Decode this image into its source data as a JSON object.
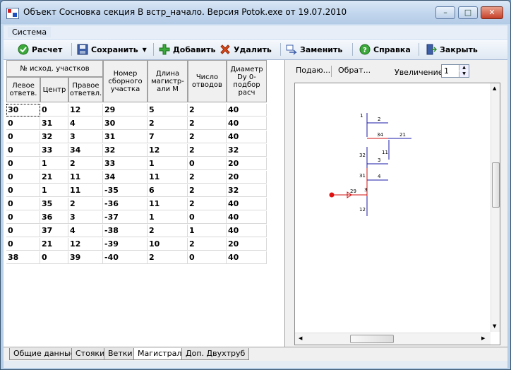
{
  "window": {
    "title": "Объект Сосновка секция В встр_начало. Версия Potok.exe от 19.07.2010"
  },
  "menu": {
    "items": [
      "Система"
    ]
  },
  "toolbar": {
    "calc": "Расчет",
    "save": "Сохранить",
    "add": "Добавить",
    "delete": "Удалить",
    "replace": "Заменить",
    "help": "Справка",
    "close": "Закрыть"
  },
  "table": {
    "group_header": "№ исход.  участков",
    "columns": [
      "Левое ответв.",
      "Центр",
      "Правое ответвл.",
      "Номер сборного участка",
      "Длина магистр-али  М",
      "Число отводов",
      "Диаметр Dy 0-подбор расч"
    ],
    "rows": [
      [
        "30",
        "0",
        "12",
        "29",
        "5",
        "2",
        "40"
      ],
      [
        "0",
        "31",
        "4",
        "30",
        "2",
        "2",
        "40"
      ],
      [
        "0",
        "32",
        "3",
        "31",
        "7",
        "2",
        "40"
      ],
      [
        "0",
        "33",
        "34",
        "32",
        "12",
        "2",
        "32"
      ],
      [
        "0",
        "1",
        "2",
        "33",
        "1",
        "0",
        "20"
      ],
      [
        "0",
        "21",
        "11",
        "34",
        "11",
        "2",
        "20"
      ],
      [
        "0",
        "1",
        "11",
        "-35",
        "6",
        "2",
        "32"
      ],
      [
        "0",
        "35",
        "2",
        "-36",
        "11",
        "2",
        "40"
      ],
      [
        "0",
        "36",
        "3",
        "-37",
        "1",
        "0",
        "40"
      ],
      [
        "0",
        "37",
        "4",
        "-38",
        "2",
        "1",
        "40"
      ],
      [
        "0",
        "21",
        "12",
        "-39",
        "10",
        "2",
        "20"
      ],
      [
        "38",
        "0",
        "39",
        "-40",
        "2",
        "0",
        "40"
      ]
    ]
  },
  "diagram_panel": {
    "feed_button": "Подаю...",
    "return_button": "Обрат...",
    "zoom_label": "Увеличение",
    "zoom_value": "1",
    "labels": [
      "1",
      "2",
      "34",
      "21",
      "32",
      "11",
      "3",
      "31",
      "4",
      "29",
      "3",
      "12"
    ]
  },
  "tabs": [
    "Общие данные",
    "Стояки",
    "Ветки",
    "Магистрали",
    "Доп. Двухтруб"
  ],
  "colors": {
    "blue_line": "#1a1aa8",
    "red_line": "#d01010",
    "node": "#e01010"
  }
}
